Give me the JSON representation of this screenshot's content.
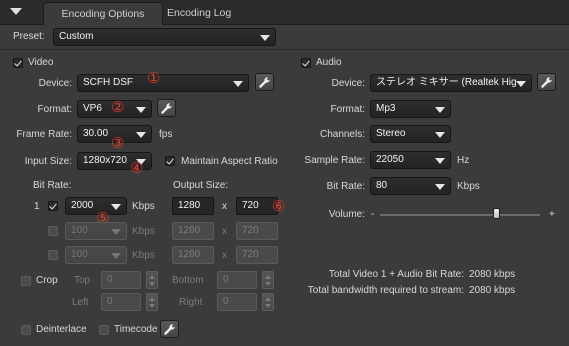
{
  "tabs": [
    {
      "label": "Encoding Options"
    },
    {
      "label": "Encoding Log"
    }
  ],
  "preset": {
    "label": "Preset:",
    "value": "Custom"
  },
  "video": {
    "section_label": "Video",
    "device": {
      "label": "Device:",
      "value": "SCFH DSF",
      "callout": "①"
    },
    "format": {
      "label": "Format:",
      "value": "VP6",
      "callout": "②"
    },
    "frame_rate": {
      "label": "Frame Rate:",
      "value": "30.00",
      "unit": "fps",
      "callout": "③"
    },
    "input_size": {
      "label": "Input Size:",
      "value": "1280x720",
      "callout": "④"
    },
    "maintain_aspect": {
      "label": "Maintain Aspect Ratio",
      "checked": true
    },
    "bit_rate_label": "Bit Rate:",
    "output_size_label": "Output Size:",
    "rows": [
      {
        "index": "1",
        "bitrate": "2000",
        "unit": "Kbps",
        "width": "1280",
        "sep": "x",
        "height": "720",
        "enabled": true
      },
      {
        "index": "",
        "bitrate": "100",
        "unit": "Kbps",
        "width": "1280",
        "sep": "x",
        "height": "720",
        "enabled": false
      },
      {
        "index": "",
        "bitrate": "100",
        "unit": "Kbps",
        "width": "1280",
        "sep": "x",
        "height": "720",
        "enabled": false
      }
    ],
    "callout_bitrate": "⑤",
    "callout_height": "⑥",
    "crop": {
      "label": "Crop",
      "top": "Top",
      "bottom": "Bottom",
      "left": "Left",
      "right": "Right",
      "value": "0"
    },
    "deinterlace": {
      "label": "Deinterlace"
    },
    "timecode": {
      "label": "Timecode"
    }
  },
  "audio": {
    "section_label": "Audio",
    "device": {
      "label": "Device:",
      "value": "ステレオ ミキサー (Realtek High D"
    },
    "format": {
      "label": "Format:",
      "value": "Mp3"
    },
    "channels": {
      "label": "Channels:",
      "value": "Stereo"
    },
    "sample_rate": {
      "label": "Sample Rate:",
      "value": "22050",
      "unit": "Hz"
    },
    "bit_rate": {
      "label": "Bit Rate:",
      "value": "80",
      "unit": "Kbps"
    },
    "volume": {
      "label": "Volume:",
      "minus": "-",
      "plus": "+",
      "level": 0.73
    }
  },
  "summary": {
    "total_bitrate_label": "Total Video 1 + Audio Bit Rate:",
    "total_bitrate_value": "2080 kbps",
    "bandwidth_label": "Total bandwidth required to stream:",
    "bandwidth_value": "2080 kbps"
  }
}
